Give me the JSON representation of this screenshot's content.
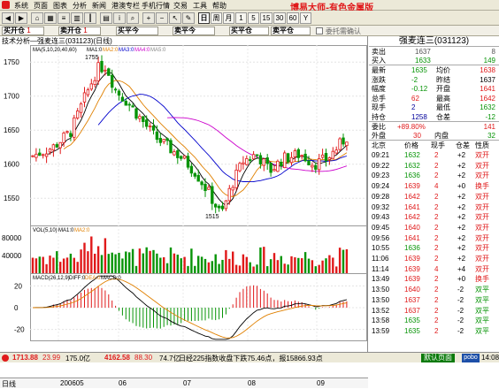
{
  "menu": [
    "系统",
    "页面",
    "图表",
    "分析",
    "新闻",
    "港澳专栏",
    "手机行情",
    "交易",
    "工具",
    "帮助"
  ],
  "brand": "博易大师-有色金属版",
  "toolbar": {
    "periods": [
      "日",
      "周",
      "月",
      "1",
      "5",
      "15",
      "30",
      "60",
      "Y"
    ],
    "selected_period": "日"
  },
  "tradebar": [
    {
      "label": "买开仓",
      "value": "1"
    },
    {
      "label": "卖开仓",
      "value": "1"
    },
    {
      "label": "买平今",
      "value": ""
    },
    {
      "label": "卖平今",
      "value": ""
    },
    {
      "label": "买平仓",
      "value": ""
    },
    {
      "label": "卖平仓",
      "value": ""
    }
  ],
  "tradebar_checkbox": "委托需确认",
  "chart": {
    "header": "技术分析—强麦连三(031123)(日线)",
    "ma_legend": {
      "prefix": "MA(5,10,20,40,60)",
      "items": [
        "MA1:0",
        "MA2:0",
        "MA3:0",
        "MA4:0",
        "MA5:0"
      ],
      "colors": [
        "#000000",
        "#e08000",
        "#0000cc",
        "#cc00cc",
        "#888888"
      ]
    },
    "vol_legend": {
      "prefix": "VOL(5,10)",
      "items": [
        "MA1:0",
        "MA2:0"
      ]
    },
    "macd_legend": {
      "prefix": "MACD(26,12,9)",
      "items": [
        "DIFF:0",
        "DEA:0",
        "MACD:0"
      ]
    },
    "price_ticks": [
      "1750",
      "1700",
      "1650",
      "1600",
      "1550"
    ],
    "vol_ticks": [
      "80000",
      "40000"
    ],
    "macd_ticks": [
      "20",
      "0",
      "-20"
    ],
    "high_label": "1755",
    "low_label": "1515",
    "x_labels": [
      "日线",
      "200605",
      "06",
      "07",
      "08",
      "09"
    ]
  },
  "quote": {
    "title": "强麦连三(031123)",
    "sell": {
      "label": "卖出",
      "price": "1637",
      "vol": "8"
    },
    "buy": {
      "label": "买入",
      "price": "1633",
      "vol": "149"
    },
    "rows": [
      [
        "最新",
        "1635",
        "均价",
        "1638"
      ],
      [
        "涨跌",
        "-2",
        "昨结",
        "1637"
      ],
      [
        "幅度",
        "-0.12",
        "开盘",
        "1641"
      ],
      [
        "总手",
        "62",
        "最高",
        "1642"
      ],
      [
        "现手",
        "2",
        "最低",
        "1632"
      ],
      [
        "持仓",
        "1258",
        "仓差",
        "-12"
      ]
    ],
    "weibi": {
      "label": "委比",
      "pct": "+89.80%",
      "val": "141"
    },
    "wai": {
      "label": "外盘",
      "val": "30"
    },
    "nei": {
      "label": "内盘",
      "val": "32"
    },
    "tick_header": [
      "北京",
      "价格",
      "现手",
      "仓差",
      "性质"
    ],
    "ticks": [
      [
        "09:21",
        "1632",
        "2",
        "+2",
        "双开"
      ],
      [
        "09:22",
        "1632",
        "2",
        "+2",
        "双开"
      ],
      [
        "09:23",
        "1636",
        "2",
        "+2",
        "双开"
      ],
      [
        "09:24",
        "1639",
        "4",
        "+0",
        "换手"
      ],
      [
        "09:28",
        "1642",
        "2",
        "+2",
        "双开"
      ],
      [
        "09:32",
        "1641",
        "2",
        "+2",
        "双开"
      ],
      [
        "09:43",
        "1642",
        "2",
        "+2",
        "双开"
      ],
      [
        "09:45",
        "1640",
        "2",
        "+2",
        "双开"
      ],
      [
        "09:56",
        "1641",
        "2",
        "+2",
        "双开"
      ],
      [
        "10:55",
        "1636",
        "2",
        "+2",
        "双开"
      ],
      [
        "11:06",
        "1639",
        "2",
        "+2",
        "双开"
      ],
      [
        "11:14",
        "1639",
        "4",
        "+4",
        "双开"
      ],
      [
        "13:49",
        "1639",
        "2",
        "+0",
        "换手"
      ],
      [
        "13:50",
        "1640",
        "2",
        "-2",
        "双平"
      ],
      [
        "13:50",
        "1637",
        "2",
        "-2",
        "双平"
      ],
      [
        "13:52",
        "1637",
        "2",
        "-2",
        "双平"
      ],
      [
        "13:58",
        "1635",
        "2",
        "-2",
        "双平"
      ],
      [
        "13:59",
        "1635",
        "2",
        "-2",
        "双平"
      ]
    ]
  },
  "status": {
    "items": [
      {
        "text": "1713.88",
        "color": "#e0191a"
      },
      {
        "text": "23.99",
        "color": "#e0191a"
      },
      {
        "text": "175.0亿",
        "color": "#000"
      },
      {
        "text": "4162.58",
        "color": "#e0191a"
      },
      {
        "text": "88.30",
        "color": "#e0191a"
      },
      {
        "text": "74.7亿",
        "color": "#000"
      }
    ],
    "news": "日经225指数收盘下跌75.46点，报15866.93点",
    "conn": "默认页面",
    "clock": "14:08"
  }
}
